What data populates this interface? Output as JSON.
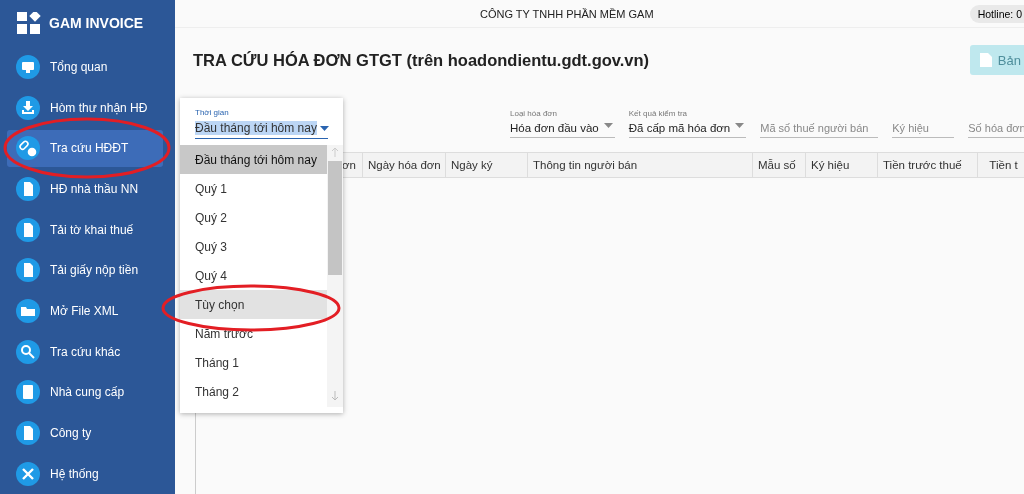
{
  "app": {
    "name": "GAM INVOICE"
  },
  "sidebar": {
    "items": [
      {
        "label": "Tổng quan",
        "selected": false
      },
      {
        "label": "Hòm thư nhận HĐ",
        "selected": false
      },
      {
        "label": "Tra cứu HĐĐT",
        "selected": true
      },
      {
        "label": "HĐ nhà thầu NN",
        "selected": false
      },
      {
        "label": "Tải tờ khai thuế",
        "selected": false
      },
      {
        "label": "Tải giấy nộp tiền",
        "selected": false
      },
      {
        "label": "Mở File XML",
        "selected": false
      },
      {
        "label": "Tra cứu khác",
        "selected": false
      },
      {
        "label": "Nhà cung cấp",
        "selected": false
      },
      {
        "label": "Công ty",
        "selected": false
      },
      {
        "label": "Hệ thống",
        "selected": false
      }
    ]
  },
  "top_bar": {
    "company": "CÔNG TY TNHH PHẦN MỀM GAM",
    "hotline": "Hotline: 0"
  },
  "page": {
    "title": "TRA CỨU HÓA ĐƠN GTGT (trên hoadondientu.gdt.gov.vn)",
    "export_button": {
      "label": "Bản",
      "disabled": true
    }
  },
  "filters": [
    {
      "kind": "select",
      "label": "Thời gian",
      "value": "Đầu tháng tới hôm nay",
      "open": true
    },
    {
      "kind": "select",
      "label": "Loại hóa đơn",
      "value": "Hóa đơn đầu vào",
      "open": false
    },
    {
      "kind": "select",
      "label": "Kết quả kiểm tra",
      "value": "Đã cấp mã hóa đơn",
      "open": false
    },
    {
      "kind": "text",
      "placeholder": "Mã số thuế người bán"
    },
    {
      "kind": "text",
      "placeholder": "Ký hiệu"
    },
    {
      "kind": "text",
      "placeholder": "Số hóa đơn"
    }
  ],
  "dropdown_options": [
    {
      "label": "Đầu tháng tới hôm nay",
      "selected": true,
      "highlighted": false
    },
    {
      "label": "Quý 1",
      "selected": false,
      "highlighted": false
    },
    {
      "label": "Quý 2",
      "selected": false,
      "highlighted": false
    },
    {
      "label": "Quý 3",
      "selected": false,
      "highlighted": false
    },
    {
      "label": "Quý 4",
      "selected": false,
      "highlighted": false
    },
    {
      "label": "Tùy chọn",
      "selected": false,
      "highlighted": true
    },
    {
      "label": "Năm trước",
      "selected": false,
      "highlighted": false
    },
    {
      "label": "Tháng 1",
      "selected": false,
      "highlighted": false
    },
    {
      "label": "Tháng 2",
      "selected": false,
      "highlighted": false
    }
  ],
  "table": {
    "columns": [
      "ơn",
      "Ngày hóa đơn",
      "Ngày ký",
      "Thông tin người bán",
      "Mẫu số",
      "Ký hiệu",
      "Tiền trước thuế",
      "Tiền t"
    ]
  }
}
